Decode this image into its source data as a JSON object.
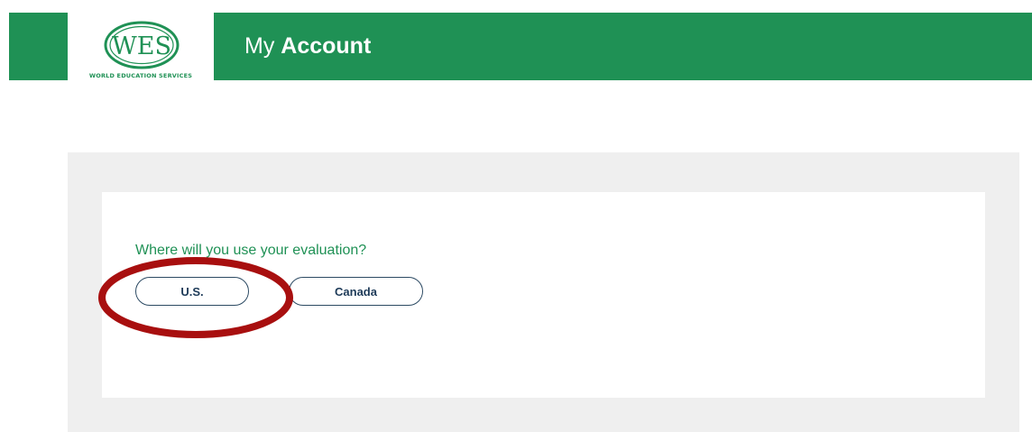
{
  "header": {
    "logo": {
      "mark_text": "WES",
      "subtitle": "WORLD EDUCATION SERVICES"
    },
    "title_regular": "My",
    "title_bold": "Account"
  },
  "evaluation": {
    "question": "Where will you use your evaluation?",
    "options": [
      {
        "label": "U.S.",
        "highlighted": true
      },
      {
        "label": "Canada",
        "highlighted": false
      }
    ]
  },
  "colors": {
    "brand_green": "#1f9155",
    "button_border": "#2c4a63",
    "button_text": "#1d3a58",
    "panel_gray": "#efefef",
    "annotation_red": "#a80f0f"
  }
}
